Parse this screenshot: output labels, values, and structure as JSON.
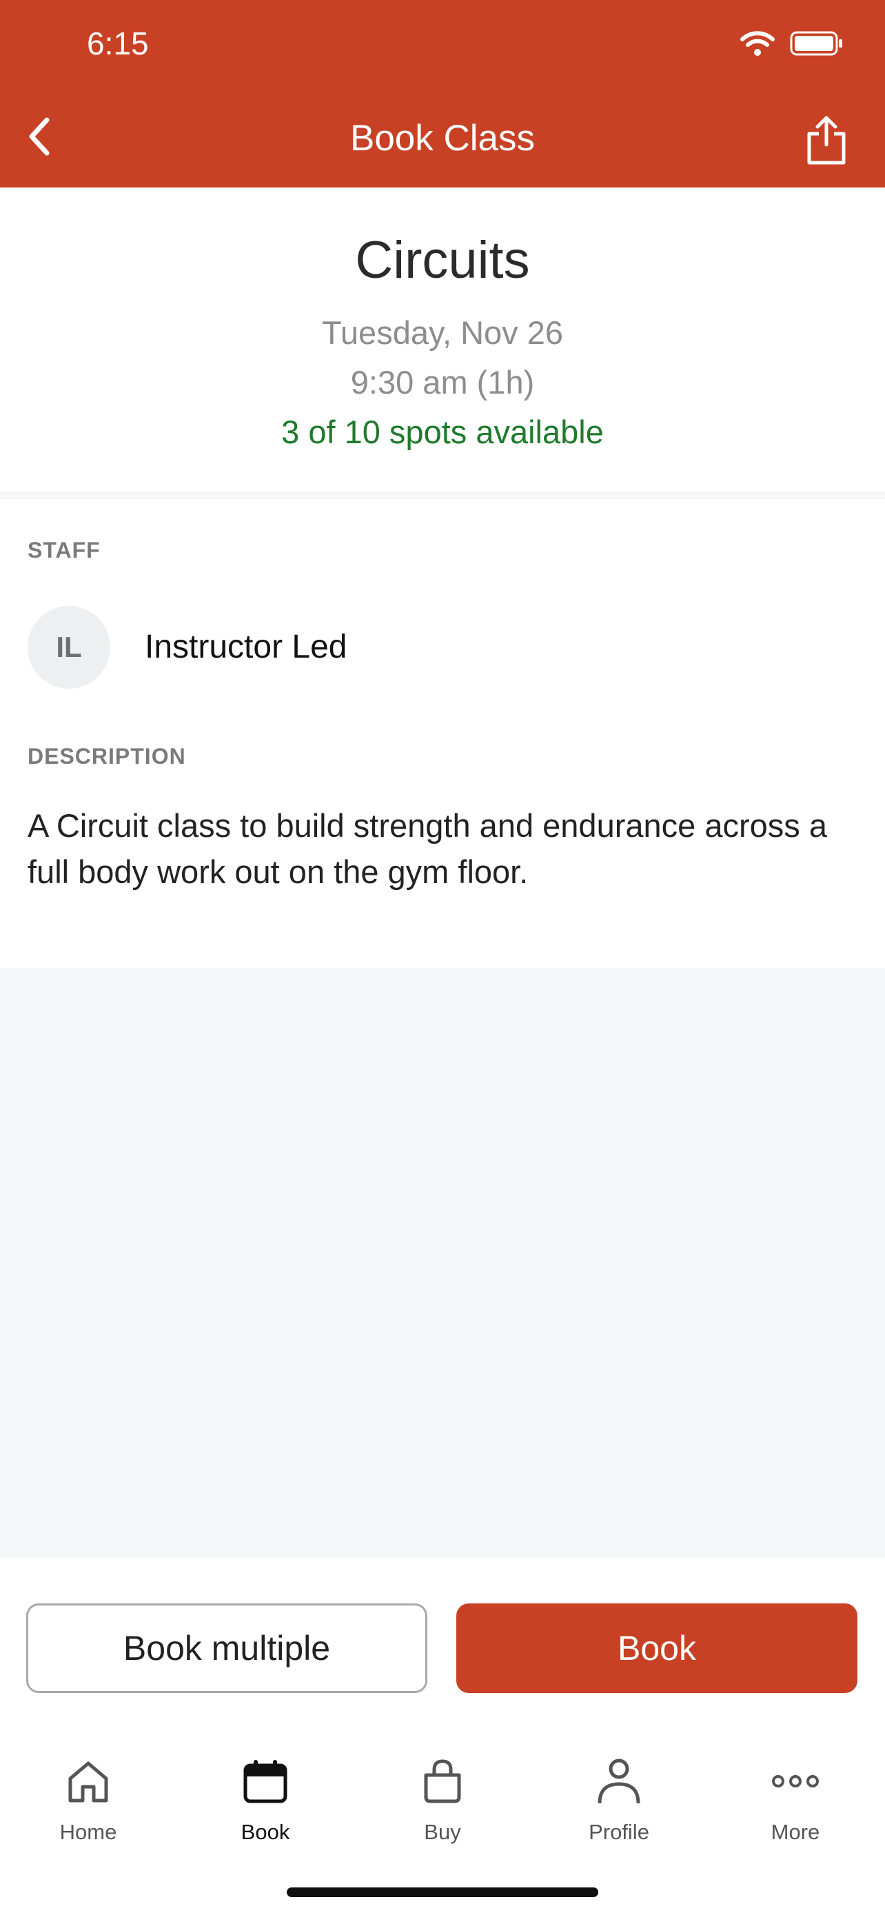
{
  "status_bar": {
    "time": "6:15"
  },
  "nav": {
    "title": "Book Class"
  },
  "class": {
    "name": "Circuits",
    "date": "Tuesday, Nov 26",
    "time": "9:30 am (1h)",
    "spots": "3 of 10 spots available"
  },
  "staff": {
    "heading": "STAFF",
    "initials": "IL",
    "name": "Instructor Led"
  },
  "description": {
    "heading": "DESCRIPTION",
    "text": "A Circuit class to build strength and endurance across a full body work out on the gym floor."
  },
  "actions": {
    "book_multiple": "Book multiple",
    "book": "Book"
  },
  "tabs": [
    {
      "label": "Home",
      "icon": "home-icon"
    },
    {
      "label": "Book",
      "icon": "calendar-icon",
      "active": true
    },
    {
      "label": "Buy",
      "icon": "shopping-bag-icon"
    },
    {
      "label": "Profile",
      "icon": "person-icon"
    },
    {
      "label": "More",
      "icon": "more-dots-icon"
    }
  ],
  "colors": {
    "brand": "#c84124",
    "available": "#1f7a2c"
  }
}
